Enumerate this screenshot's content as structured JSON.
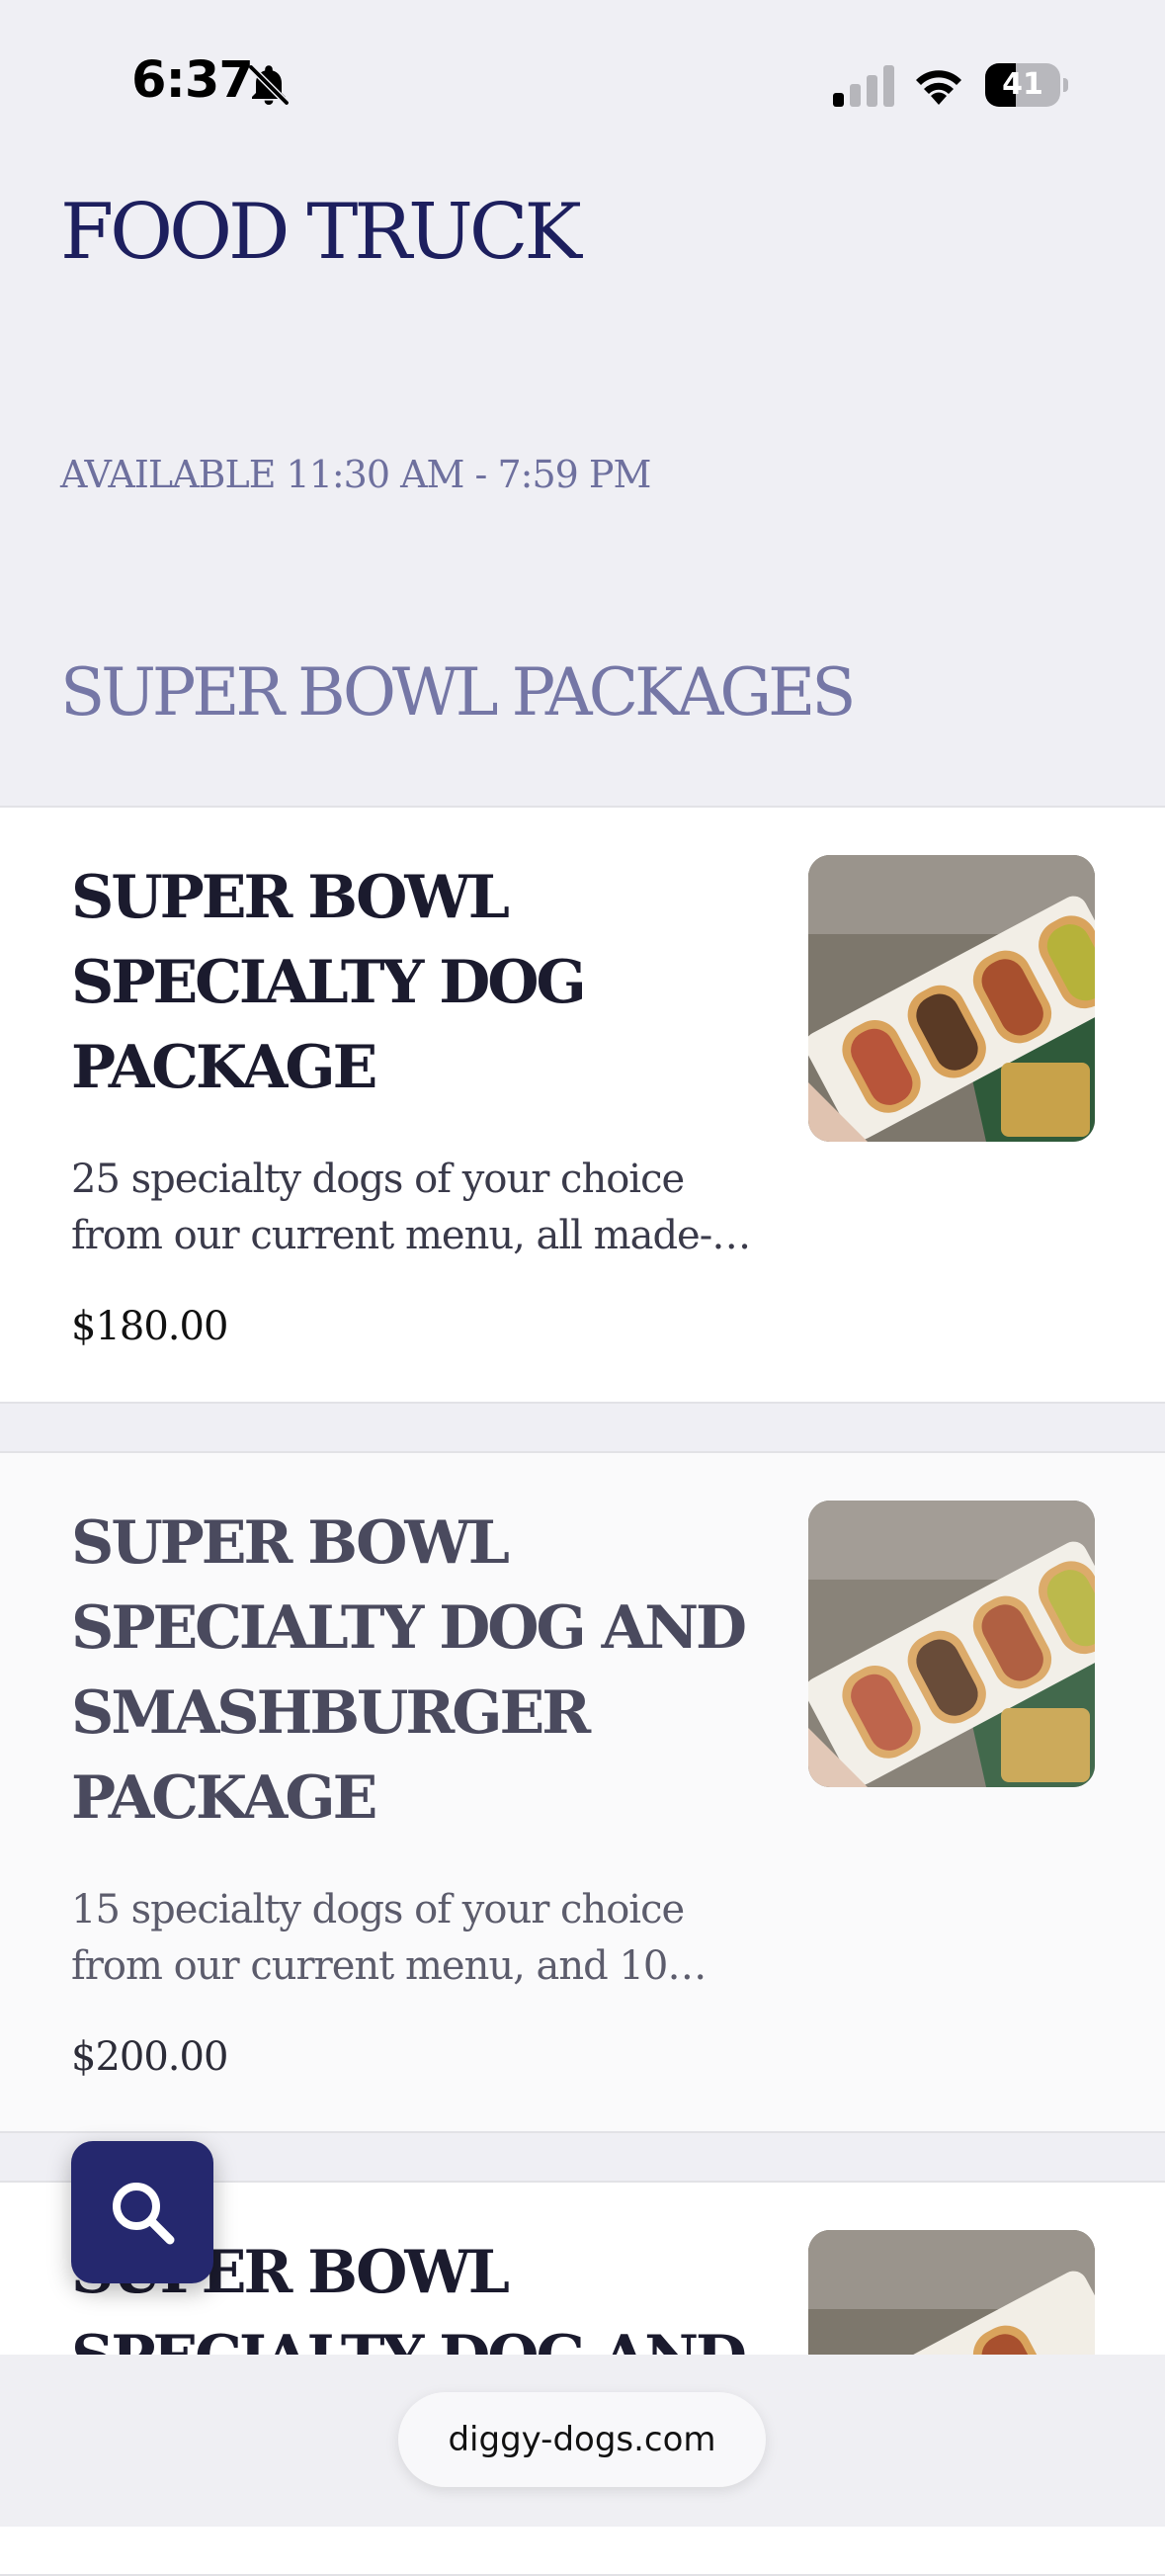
{
  "status_bar": {
    "time": "6:37",
    "battery_level": "41",
    "battery_fraction": 0.41,
    "icons": [
      "bell-slash-icon",
      "signal-icon",
      "wifi-icon",
      "battery-icon"
    ]
  },
  "menu": {
    "title": "FOOD TRUCK",
    "availability": "AVAILABLE 11:30 AM - 7:59 PM",
    "section_title": "SUPER BOWL PACKAGES",
    "items": [
      {
        "name": "SUPER BOWL SPECIALTY DOG PACKAGE",
        "description_lines": [
          "25 specialty dogs of your choice",
          "from our current menu, all made-…"
        ],
        "price": "$180.00"
      },
      {
        "name": "SUPER BOWL SPECIALTY DOG AND SMASHBURGER PACKAGE",
        "description_lines": [
          "15 specialty dogs of your choice",
          "from our current menu, and 10…"
        ],
        "price": "$200.00"
      },
      {
        "name": "SUPER BOWL SPECIALTY DOG AND"
      }
    ]
  },
  "search_button": {
    "icon": "search-icon"
  },
  "browser": {
    "url": "diggy-dogs.com"
  },
  "colors": {
    "brand_navy": "#25286e",
    "title_navy": "#1d1f5e",
    "section_lavender": "#7577a6",
    "page_background": "#efeff4"
  }
}
